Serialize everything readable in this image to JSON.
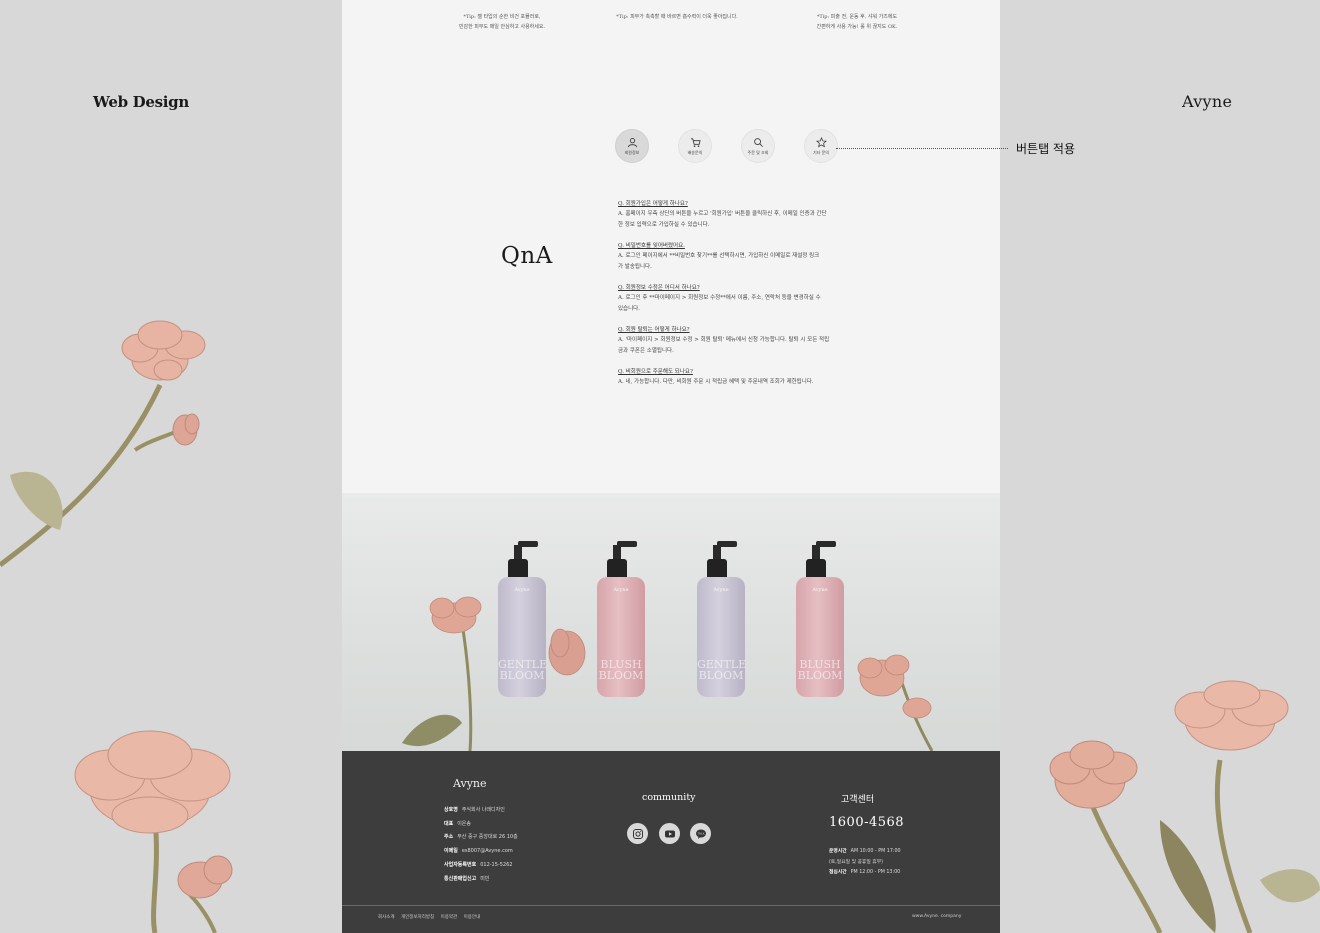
{
  "side": {
    "left_title": "Web Design",
    "right_title": "Avyne"
  },
  "tips": [
    {
      "line1": "*Tip: 젤 타입의 순한 비건 포뮬러로,",
      "line2": "민감한 피부도 매일 안심하고 사용하세요."
    },
    {
      "line1": "*Tip: 피부가 촉촉할 때 바르면 흡수력이 더욱 좋아집니다.",
      "line2": ""
    },
    {
      "line1": "*Tip: 피출 전, 운동 후, 샤워 가즈에도",
      "line2": "간편하게 사용 가능! 롤 위 끊지도 OK."
    }
  ],
  "tabs": [
    {
      "label": "회원정보",
      "icon": "user-icon"
    },
    {
      "label": "배송문의",
      "icon": "cart-icon"
    },
    {
      "label": "주문 및 조회",
      "icon": "search-icon"
    },
    {
      "label": "기타 문의",
      "icon": "star-icon"
    }
  ],
  "callout": {
    "text": "버튼탭 적용"
  },
  "qna": {
    "title": "QnA",
    "items": [
      {
        "q": "Q. 회원가입은 어떻게 하나요?",
        "a1": "A. 홈페이지 우측 상단의 버튼을 누르고 '회원가입' 버튼을 클릭하신 후, 이메일 인증과 간단",
        "a2": "한 정보 입력으로 가입하실 수 있습니다."
      },
      {
        "q": "Q. 비밀번호를 잊어버렸어요.",
        "a1": "A. 로그인 페이지에서 **비밀번호 찾기**를 선택하시면, 가입하신 이메일로 재설정 링크",
        "a2": "가 발송됩니다."
      },
      {
        "q": "Q. 회원정보 수정은 어디서 하나요?",
        "a1": "A. 로그인 후 **마이페이지 > 회원정보 수정**에서 이름, 주소, 연락처 등을 변경하실 수",
        "a2": "있습니다."
      },
      {
        "q": "Q. 회원 탈퇴는 어떻게 하나요?",
        "a1": "A. '마이페이지 > 회원정보 수정 > 회원 탈퇴' 메뉴에서 신청 가능합니다. 탈퇴 시 모든 적립",
        "a2": "금과 쿠폰은 소멸됩니다."
      },
      {
        "q": "Q. 비회원으로 주문해도 되나요?",
        "a1": "A. 네, 가능합니다. 다만, 비회원 주문 시 적립금 혜택 및 주문내역 조회가 제한됩니다.",
        "a2": ""
      }
    ]
  },
  "bottles": [
    {
      "brand": "Avyne",
      "name1": "GENTLE",
      "name2": "BLOOM",
      "tone": "lav"
    },
    {
      "brand": "Avyne",
      "name1": "BLUSH",
      "name2": "BLOOM",
      "tone": "pink"
    },
    {
      "brand": "Avyne",
      "name1": "GENTLE",
      "name2": "BLOOM",
      "tone": "lav"
    },
    {
      "brand": "Avyne",
      "name1": "BLUSH",
      "name2": "BLOOM",
      "tone": "pink"
    }
  ],
  "footer": {
    "brand": "Avyne",
    "info": [
      {
        "label": "상호명",
        "value": "주식회사 나래디자인"
      },
      {
        "label": "대표",
        "value": "이은송"
      },
      {
        "label": "주소",
        "value": "부산 중구 중앙대로 26 10층"
      },
      {
        "label": "이메일",
        "value": "es8007@Avyne.com"
      },
      {
        "label": "사업자등록번호",
        "value": "012-15-5262"
      },
      {
        "label": "통신판매업신고",
        "value": "미빈"
      }
    ],
    "community_title": "community",
    "community_icons": [
      "instagram-icon",
      "youtube-icon",
      "kakaotalk-icon"
    ],
    "talk_label": "TALK",
    "cs_title": "고객센터",
    "phone": "1600-4568",
    "hours": [
      {
        "label": "운영시간",
        "value": "AM 10:00 - PM 17:00"
      },
      {
        "label": "",
        "value": "(토,일요일 및 공휴일 휴무)"
      },
      {
        "label": "점심시간",
        "value": "PM 12:00 - PM 13:00"
      }
    ],
    "links": [
      "회사소개",
      "개인정보처리방침",
      "이용약관",
      "이용안내"
    ],
    "site": "www.Avyne. company"
  }
}
